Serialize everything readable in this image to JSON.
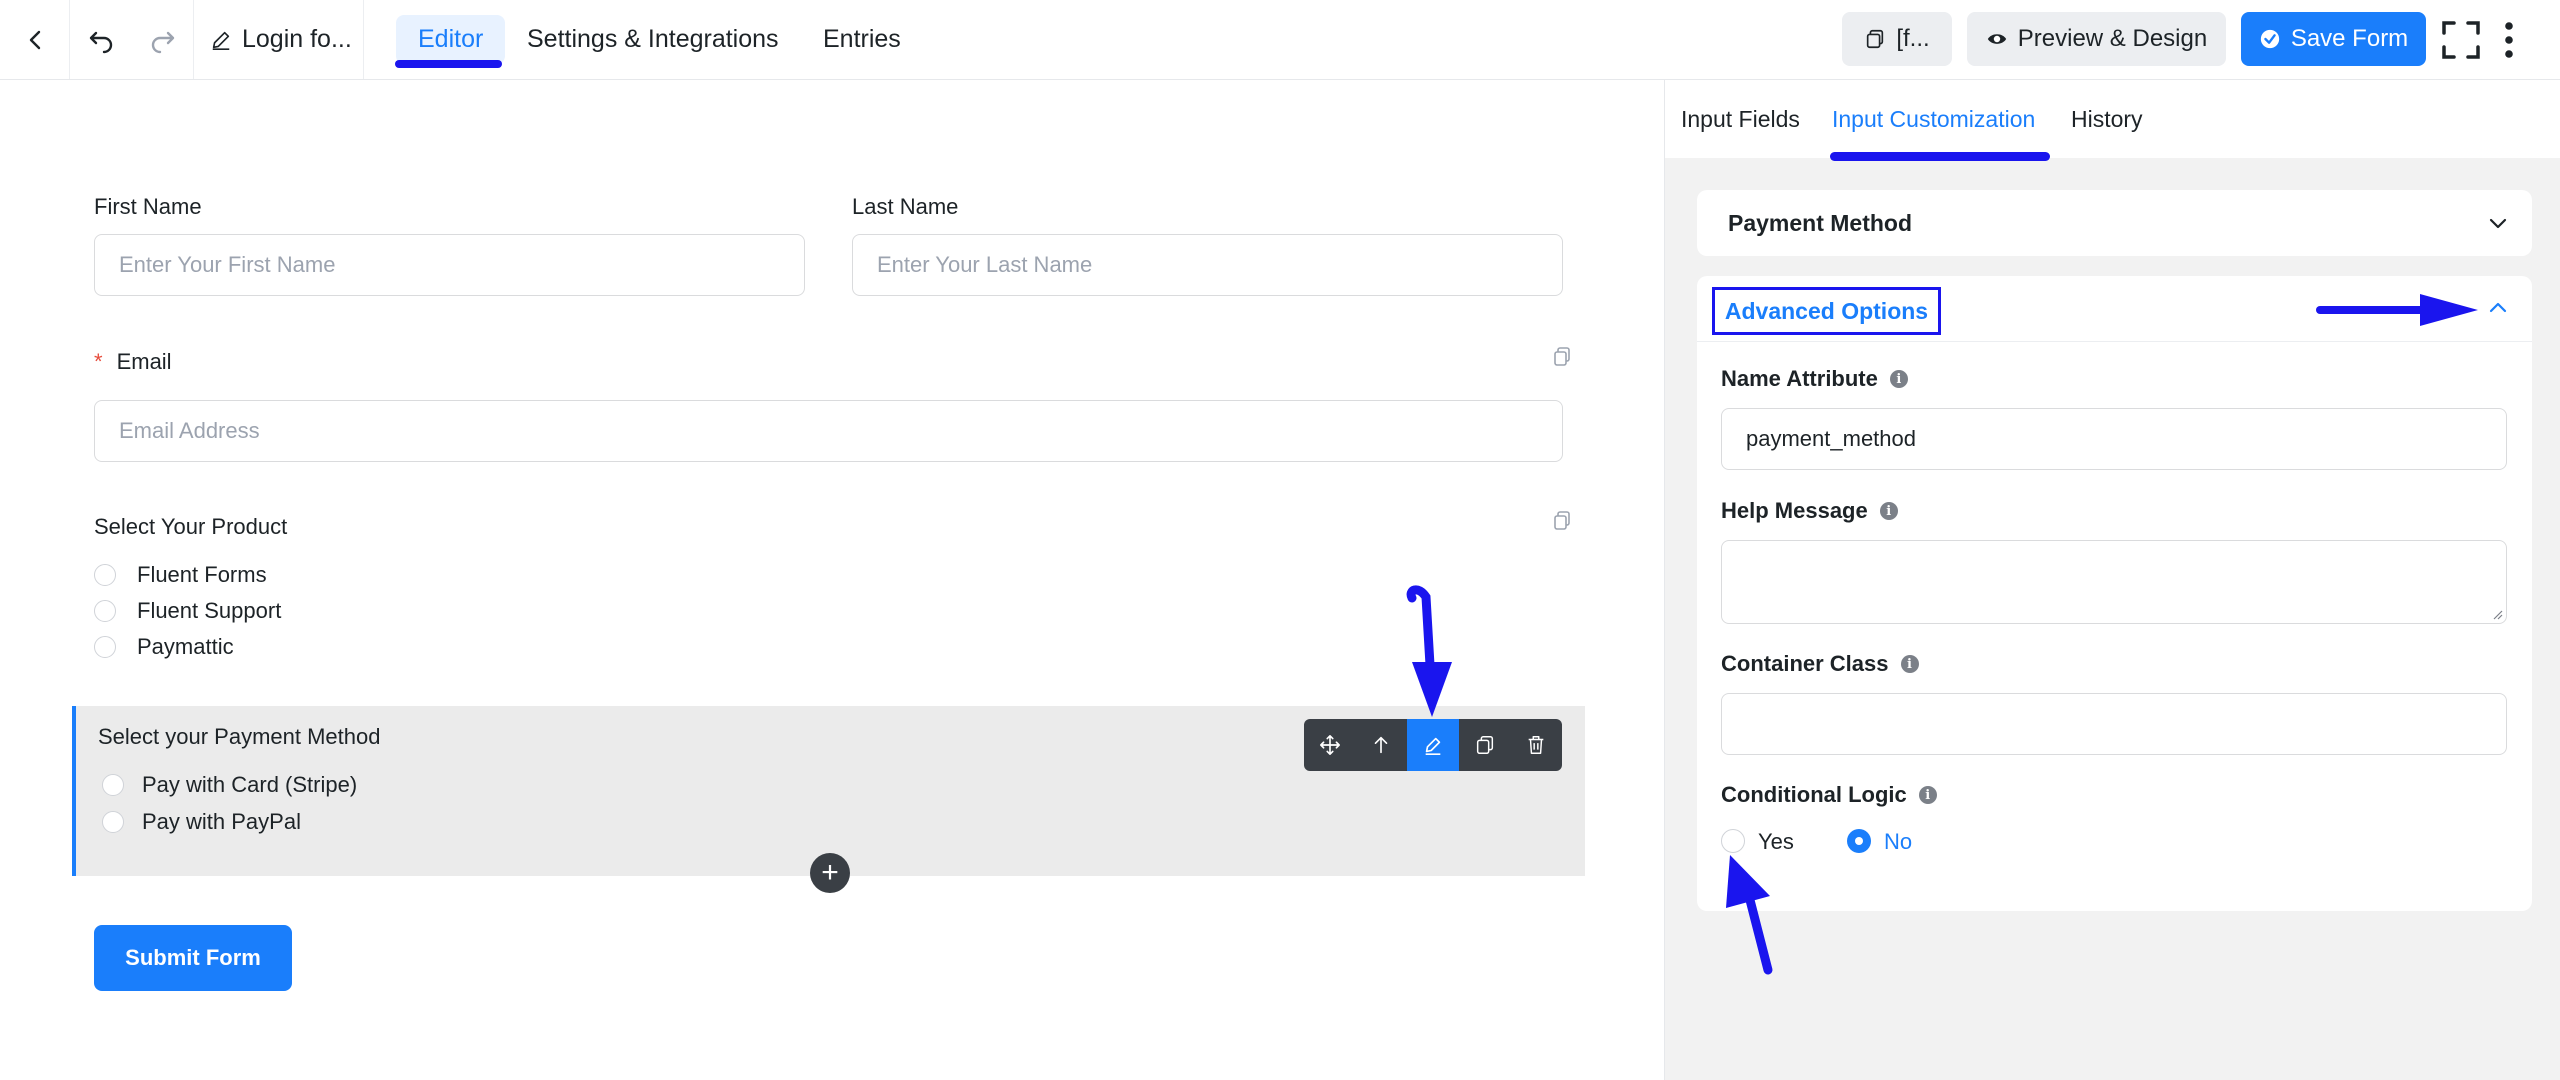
{
  "topbar": {
    "title": "Login fo...",
    "tabs": [
      "Editor",
      "Settings & Integrations",
      "Entries"
    ],
    "shortcode_label": "[f...",
    "preview_label": "Preview & Design",
    "save_label": "Save Form"
  },
  "form": {
    "first_name_label": "First Name",
    "first_name_placeholder": "Enter Your First Name",
    "last_name_label": "Last Name",
    "last_name_placeholder": "Enter Your Last Name",
    "email_required_mark": "*",
    "email_label": "Email",
    "email_placeholder": "Email Address",
    "product_label": "Select Your Product",
    "product_options": [
      "Fluent Forms",
      "Fluent Support",
      "Paymattic"
    ],
    "payment_label": "Select your Payment Method",
    "payment_options": [
      "Pay with Card (Stripe)",
      "Pay with PayPal"
    ],
    "submit_label": "Submit Form"
  },
  "panel": {
    "tabs": [
      "Input Fields",
      "Input Customization",
      "History"
    ],
    "section_title": "Payment Method",
    "advanced_title": "Advanced Options",
    "name_attr_label": "Name Attribute",
    "name_attr_value": "payment_method",
    "help_label": "Help Message",
    "help_value": "",
    "container_label": "Container Class",
    "container_value": "",
    "conditional_label": "Conditional Logic",
    "conditional_options": [
      "Yes",
      "No"
    ],
    "conditional_selected": "No"
  },
  "colors": {
    "accent": "#1a7efb",
    "annotation": "#1a15ee"
  }
}
